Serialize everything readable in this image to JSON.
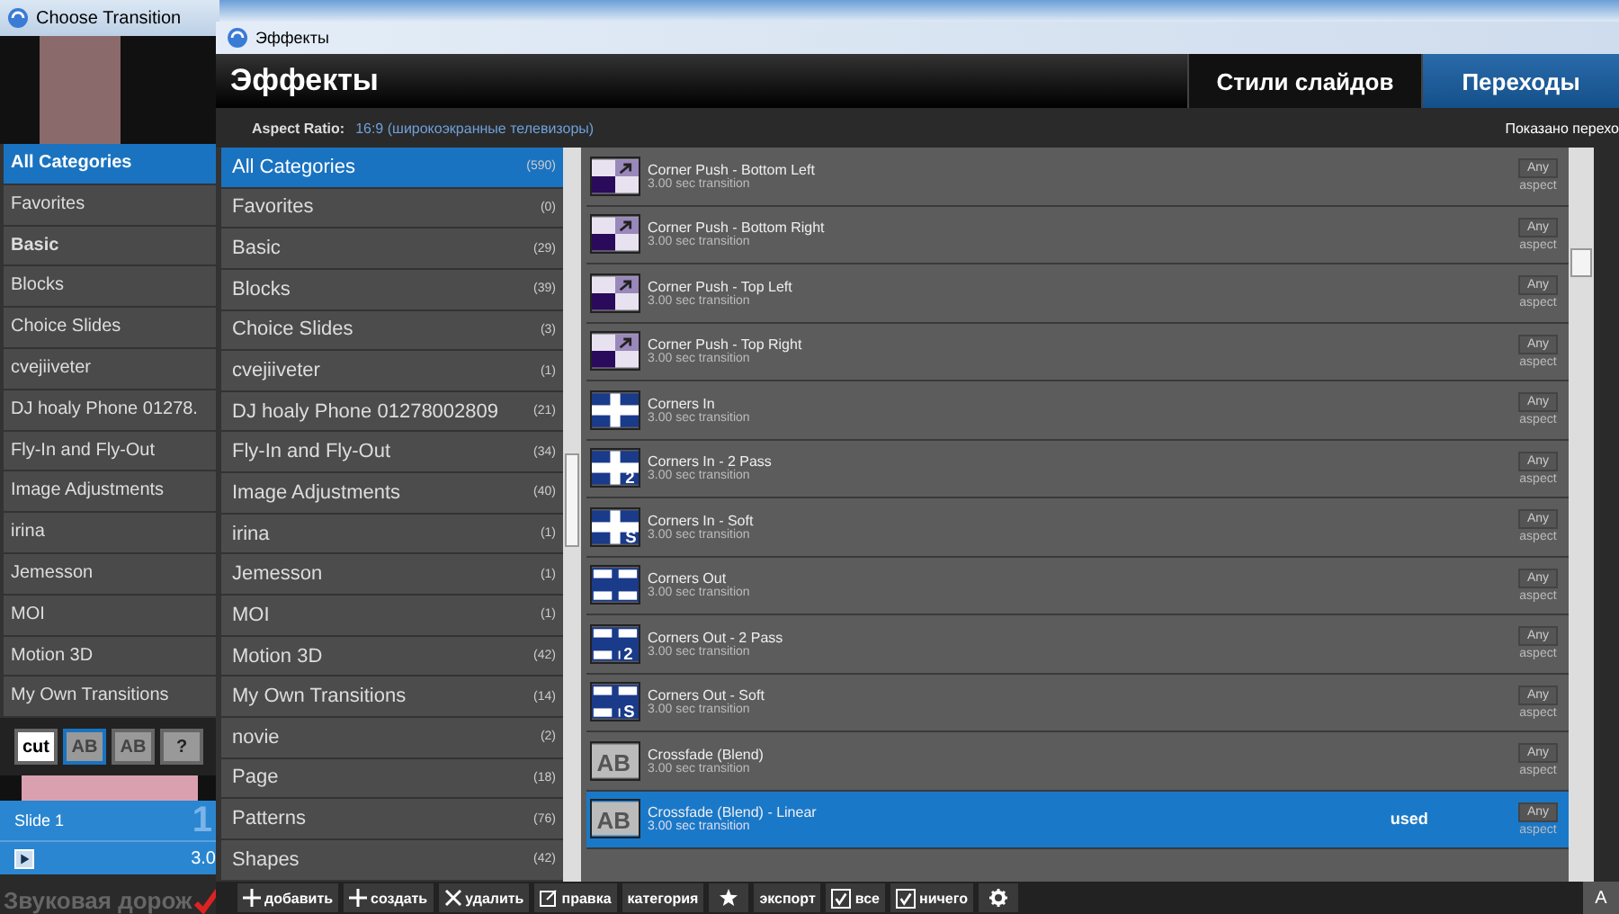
{
  "back_window": {
    "title": "Choose Transition",
    "categories": [
      {
        "label": "All Categories",
        "selected": true,
        "bold": true
      },
      {
        "label": "Favorites",
        "selected": false,
        "bold": false
      },
      {
        "label": "Basic",
        "selected": false,
        "bold": true
      },
      {
        "label": "Blocks",
        "selected": false,
        "bold": false
      },
      {
        "label": "Choice Slides",
        "selected": false,
        "bold": false
      },
      {
        "label": "cvejiiveter",
        "selected": false,
        "bold": false
      },
      {
        "label": "DJ hoaly Phone 01278.",
        "selected": false,
        "bold": false
      },
      {
        "label": "Fly-In and Fly-Out",
        "selected": false,
        "bold": false
      },
      {
        "label": "Image Adjustments",
        "selected": false,
        "bold": false
      },
      {
        "label": "irina",
        "selected": false,
        "bold": false
      },
      {
        "label": "Jemesson",
        "selected": false,
        "bold": false
      },
      {
        "label": "MOI",
        "selected": false,
        "bold": false
      },
      {
        "label": "Motion 3D",
        "selected": false,
        "bold": false
      },
      {
        "label": "My Own Transitions",
        "selected": false,
        "bold": false
      }
    ],
    "tools": [
      {
        "label": "cut",
        "kind": "cut",
        "selected": false
      },
      {
        "label": "AB",
        "kind": "ab",
        "selected": true
      },
      {
        "label": "AB",
        "kind": "ab",
        "selected": false
      },
      {
        "label": "?",
        "kind": "help",
        "selected": false
      }
    ],
    "slide": {
      "title": "Slide 1",
      "number": "1",
      "duration": "3.0"
    },
    "audio_track": "Звуковая дорож"
  },
  "window": {
    "title": "Эффекты",
    "heading": "Эффекты",
    "tabs": [
      {
        "label": "Стили слайдов",
        "selected": false
      },
      {
        "label": "Переходы",
        "selected": true
      }
    ],
    "aspect_label": "Aspect Ratio:",
    "aspect_value": "16:9 (широкоэкранные телевизоры)",
    "shown": "Показано перехо",
    "categories": [
      {
        "label": "All Categories",
        "count": "(590)",
        "selected": true
      },
      {
        "label": "Favorites",
        "count": "(0)",
        "selected": false
      },
      {
        "label": "Basic",
        "count": "(29)",
        "selected": false
      },
      {
        "label": "Blocks",
        "count": "(39)",
        "selected": false
      },
      {
        "label": "Choice Slides",
        "count": "(3)",
        "selected": false
      },
      {
        "label": "cvejiiveter",
        "count": "(1)",
        "selected": false
      },
      {
        "label": "DJ hoaly Phone 01278002809",
        "count": "(21)",
        "selected": false
      },
      {
        "label": "Fly-In and Fly-Out",
        "count": "(34)",
        "selected": false
      },
      {
        "label": "Image Adjustments",
        "count": "(40)",
        "selected": false
      },
      {
        "label": "irina",
        "count": "(1)",
        "selected": false
      },
      {
        "label": "Jemesson",
        "count": "(1)",
        "selected": false
      },
      {
        "label": "MOI",
        "count": "(1)",
        "selected": false
      },
      {
        "label": "Motion 3D",
        "count": "(42)",
        "selected": false
      },
      {
        "label": "My Own Transitions",
        "count": "(14)",
        "selected": false
      },
      {
        "label": "novie",
        "count": "(2)",
        "selected": false
      },
      {
        "label": "Page",
        "count": "(18)",
        "selected": false
      },
      {
        "label": "Patterns",
        "count": "(76)",
        "selected": false
      },
      {
        "label": "Shapes",
        "count": "(42)",
        "selected": false
      }
    ],
    "transitions": [
      {
        "name": "Corner Push - Bottom Left",
        "duration": "3.00 sec transition",
        "kind": "push",
        "aspect": "Any",
        "aspect_caption": "aspect",
        "selected": false
      },
      {
        "name": "Corner Push - Bottom Right",
        "duration": "3.00 sec transition",
        "kind": "push",
        "aspect": "Any",
        "aspect_caption": "aspect",
        "selected": false
      },
      {
        "name": "Corner Push - Top Left",
        "duration": "3.00 sec transition",
        "kind": "push",
        "aspect": "Any",
        "aspect_caption": "aspect",
        "selected": false
      },
      {
        "name": "Corner Push - Top Right",
        "duration": "3.00 sec transition",
        "kind": "push",
        "aspect": "Any",
        "aspect_caption": "aspect",
        "selected": false
      },
      {
        "name": "Corners In",
        "duration": "3.00 sec transition",
        "kind": "corners-in",
        "aspect": "Any",
        "aspect_caption": "aspect",
        "selected": false
      },
      {
        "name": "Corners In - 2 Pass",
        "duration": "3.00 sec transition",
        "kind": "corners-in",
        "badge": "2",
        "aspect": "Any",
        "aspect_caption": "aspect",
        "selected": false
      },
      {
        "name": "Corners In - Soft",
        "duration": "3.00 sec transition",
        "kind": "corners-in",
        "badge": "S",
        "aspect": "Any",
        "aspect_caption": "aspect",
        "selected": false
      },
      {
        "name": "Corners Out",
        "duration": "3.00 sec transition",
        "kind": "corners-out",
        "aspect": "Any",
        "aspect_caption": "aspect",
        "selected": false
      },
      {
        "name": "Corners Out - 2 Pass",
        "duration": "3.00 sec transition",
        "kind": "corners-out",
        "badge": "2",
        "aspect": "Any",
        "aspect_caption": "aspect",
        "selected": false
      },
      {
        "name": "Corners Out - Soft",
        "duration": "3.00 sec transition",
        "kind": "corners-out",
        "badge": "S",
        "aspect": "Any",
        "aspect_caption": "aspect",
        "selected": false
      },
      {
        "name": "Crossfade (Blend)",
        "duration": "3.00 sec transition",
        "kind": "crossfade",
        "icon_text": "AB",
        "aspect": "Any",
        "aspect_caption": "aspect",
        "selected": false
      },
      {
        "name": "Crossfade (Blend) - Linear",
        "duration": "3.00 sec transition",
        "kind": "crossfade",
        "icon_text": "AB",
        "status": "used",
        "aspect": "Any",
        "aspect_caption": "aspect",
        "selected": true
      }
    ],
    "toolbar": [
      {
        "label": "добавить",
        "kind": "plus"
      },
      {
        "label": "создать",
        "kind": "plus"
      },
      {
        "label": "удалить",
        "kind": "cross"
      },
      {
        "label": "правка",
        "kind": "edit"
      },
      {
        "label": "категория",
        "kind": "text"
      },
      {
        "kind": "star"
      },
      {
        "label": "экспорт",
        "kind": "text"
      },
      {
        "label": "все",
        "kind": "check",
        "checked": true
      },
      {
        "label": "ничего",
        "kind": "check",
        "checked": true
      },
      {
        "kind": "gear"
      }
    ],
    "corner_button": "A"
  }
}
